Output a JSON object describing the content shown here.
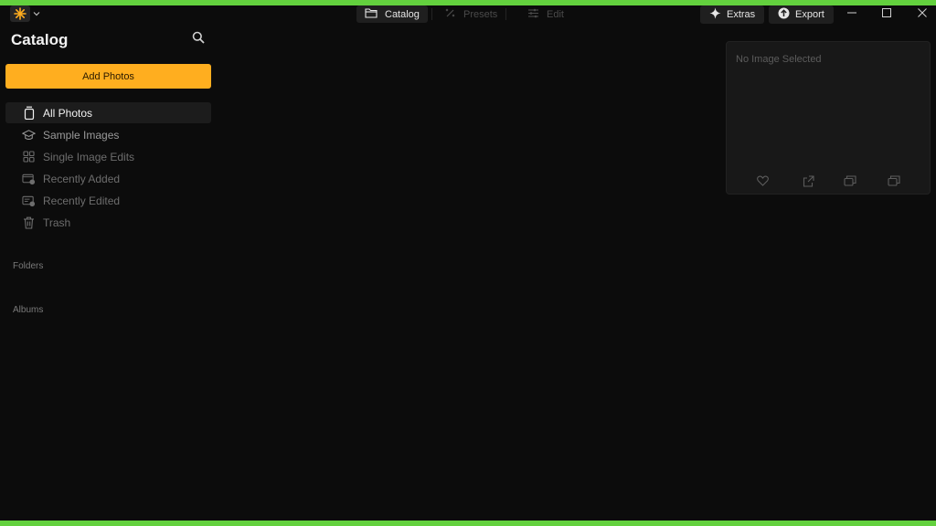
{
  "titlebar": {
    "tabs": [
      {
        "label": "Catalog",
        "icon": "folder-icon",
        "state": "active"
      },
      {
        "label": "Presets",
        "icon": "magic-wand-icon",
        "state": "disabled"
      },
      {
        "label": "Edit",
        "icon": "sliders-icon",
        "state": "disabled"
      }
    ],
    "extras_label": "Extras",
    "export_label": "Export",
    "accent_color": "#ffae1f"
  },
  "sidebar": {
    "title": "Catalog",
    "add_photos_label": "Add Photos",
    "items": [
      {
        "label": "All Photos",
        "icon": "photo-stack-icon",
        "state": "selected"
      },
      {
        "label": "Sample Images",
        "icon": "graduation-cap-icon",
        "state": "normal"
      },
      {
        "label": "Single Image Edits",
        "icon": "grid-icon",
        "state": "dim"
      },
      {
        "label": "Recently Added",
        "icon": "recently-added-icon",
        "state": "dim"
      },
      {
        "label": "Recently Edited",
        "icon": "recently-edited-icon",
        "state": "dim"
      },
      {
        "label": "Trash",
        "icon": "trash-icon",
        "state": "dim"
      }
    ],
    "sections": {
      "folders": "Folders",
      "albums": "Albums"
    }
  },
  "info_panel": {
    "empty_text": "No Image Selected",
    "icons": [
      "heart-icon",
      "share-icon",
      "copy-icon",
      "duplicate-icon"
    ]
  }
}
